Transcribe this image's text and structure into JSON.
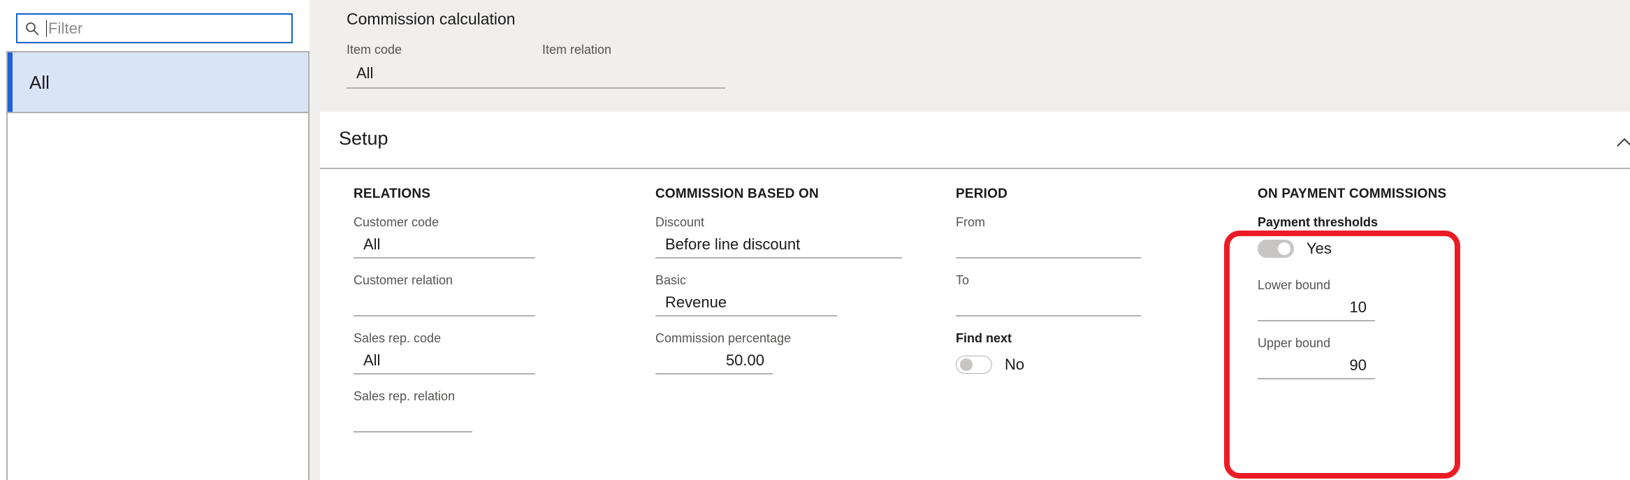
{
  "sidebar": {
    "search": {
      "icon": "search-icon",
      "placeholder": "Filter",
      "value": ""
    },
    "items": [
      {
        "label": "All",
        "selected": true
      }
    ]
  },
  "header": {
    "title": "Commission calculation",
    "fields": [
      {
        "label": "Item code",
        "value": "All"
      },
      {
        "label": "Item relation",
        "value": ""
      }
    ]
  },
  "setup": {
    "title": "Setup",
    "collapse_icon": "chevron-up-icon",
    "columns": [
      {
        "heading": "RELATIONS",
        "fields": [
          {
            "label": "Customer code",
            "value": "All",
            "type": "text"
          },
          {
            "label": "Customer relation",
            "value": "",
            "type": "text"
          },
          {
            "label": "Sales rep. code",
            "value": "All",
            "type": "text"
          },
          {
            "label": "Sales rep. relation",
            "value": "",
            "type": "text"
          }
        ]
      },
      {
        "heading": "COMMISSION BASED ON",
        "fields": [
          {
            "label": "Discount",
            "value": "Before line discount",
            "type": "text"
          },
          {
            "label": "Basic",
            "value": "Revenue",
            "type": "text"
          },
          {
            "label": "Commission percentage",
            "value": "50.00",
            "type": "number"
          }
        ]
      },
      {
        "heading": "PERIOD",
        "fields": [
          {
            "label": "From",
            "value": "",
            "type": "text"
          },
          {
            "label": "To",
            "value": "",
            "type": "text"
          },
          {
            "label": "Find next",
            "value": "No",
            "type": "toggle",
            "on": false
          }
        ]
      },
      {
        "heading": "ON PAYMENT COMMISSIONS",
        "fields": [
          {
            "label": "Payment thresholds",
            "value": "Yes",
            "type": "toggle",
            "on": true
          },
          {
            "label": "Lower bound",
            "value": "10",
            "type": "number"
          },
          {
            "label": "Upper bound",
            "value": "90",
            "type": "number"
          }
        ]
      }
    ]
  },
  "annotation": {
    "color": "#ec1c24",
    "target": "ON PAYMENT COMMISSIONS"
  }
}
